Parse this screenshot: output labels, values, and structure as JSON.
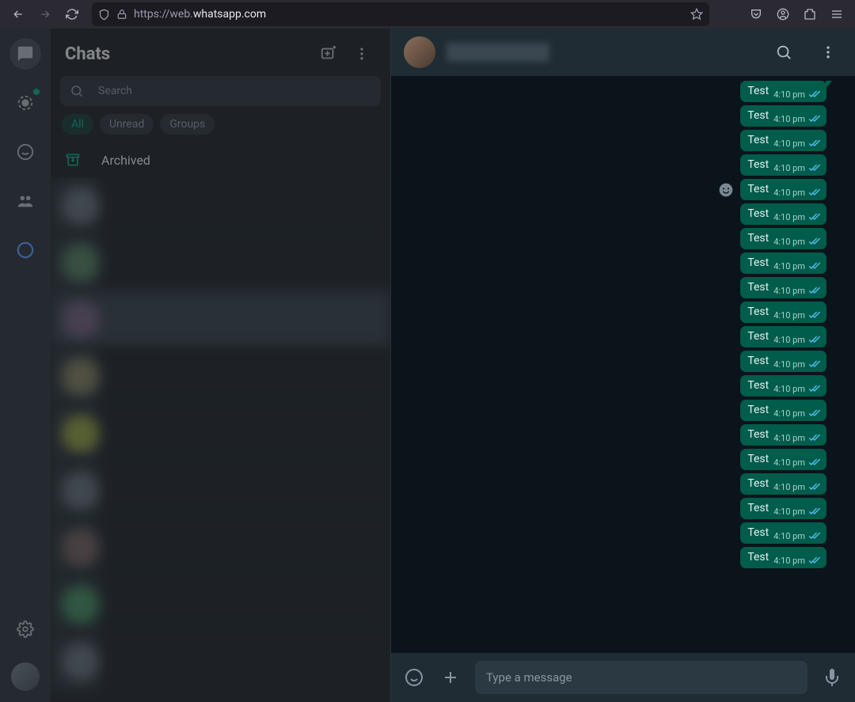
{
  "browser": {
    "url_prefix": "https://web.",
    "url_domain": "whatsapp.com"
  },
  "sidebar": {
    "title": "Chats",
    "search_placeholder": "Search",
    "filters": {
      "all": "All",
      "unread": "Unread",
      "groups": "Groups"
    },
    "archived": "Archived"
  },
  "conversation": {
    "compose_placeholder": "Type a message",
    "messages": [
      {
        "text": "Test",
        "time": "4:10 pm",
        "tail": true
      },
      {
        "text": "Test",
        "time": "4:10 pm"
      },
      {
        "text": "Test",
        "time": "4:10 pm"
      },
      {
        "text": "Test",
        "time": "4:10 pm"
      },
      {
        "text": "Test",
        "time": "4:10 pm",
        "react": true
      },
      {
        "text": "Test",
        "time": "4:10 pm"
      },
      {
        "text": "Test",
        "time": "4:10 pm"
      },
      {
        "text": "Test",
        "time": "4:10 pm"
      },
      {
        "text": "Test",
        "time": "4:10 pm"
      },
      {
        "text": "Test",
        "time": "4:10 pm"
      },
      {
        "text": "Test",
        "time": "4:10 pm"
      },
      {
        "text": "Test",
        "time": "4:10 pm"
      },
      {
        "text": "Test",
        "time": "4:10 pm"
      },
      {
        "text": "Test",
        "time": "4:10 pm"
      },
      {
        "text": "Test",
        "time": "4:10 pm"
      },
      {
        "text": "Test",
        "time": "4:10 pm"
      },
      {
        "text": "Test",
        "time": "4:10 pm"
      },
      {
        "text": "Test",
        "time": "4:10 pm"
      },
      {
        "text": "Test",
        "time": "4:10 pm"
      },
      {
        "text": "Test",
        "time": "4:10 pm"
      }
    ]
  }
}
